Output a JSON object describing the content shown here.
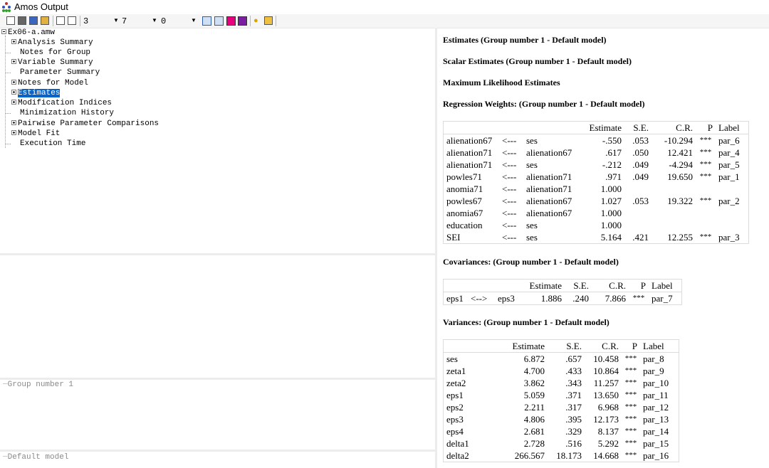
{
  "window": {
    "title": "Amos Output"
  },
  "toolbar": {
    "decimals": "3",
    "column_spacing": "7",
    "table_rows": "0"
  },
  "tree": {
    "root": "Ex06-a.amw",
    "items": [
      {
        "label": "Analysis Summary",
        "expandable": true
      },
      {
        "label": "Notes for Group",
        "expandable": false
      },
      {
        "label": "Variable Summary",
        "expandable": true
      },
      {
        "label": "Parameter Summary",
        "expandable": false
      },
      {
        "label": "Notes for Model",
        "expandable": true
      },
      {
        "label": "Estimates",
        "expandable": true,
        "selected": true
      },
      {
        "label": "Modification Indices",
        "expandable": true
      },
      {
        "label": "Minimization History",
        "expandable": false
      },
      {
        "label": "Pairwise Parameter Comparisons",
        "expandable": true
      },
      {
        "label": "Model Fit",
        "expandable": true
      },
      {
        "label": "Execution Time",
        "expandable": false
      }
    ]
  },
  "groups_pane": {
    "label": "Group number 1"
  },
  "models_pane": {
    "label": "Default model"
  },
  "output": {
    "h_estimates": "Estimates (Group number 1 - Default model)",
    "h_scalar": "Scalar Estimates (Group number 1 - Default model)",
    "h_ml": "Maximum Likelihood Estimates",
    "h_regression": "Regression Weights: (Group number 1 - Default model)",
    "h_covariances": "Covariances: (Group number 1 - Default model)",
    "h_variances": "Variances: (Group number 1 - Default model)",
    "columns": [
      "Estimate",
      "S.E.",
      "C.R.",
      "P",
      "Label"
    ],
    "regression": [
      [
        "alienation67",
        "<---",
        "ses",
        "-.550",
        ".053",
        "-10.294",
        "***",
        "par_6"
      ],
      [
        "alienation71",
        "<---",
        "alienation67",
        ".617",
        ".050",
        "12.421",
        "***",
        "par_4"
      ],
      [
        "alienation71",
        "<---",
        "ses",
        "-.212",
        ".049",
        "-4.294",
        "***",
        "par_5"
      ],
      [
        "powles71",
        "<---",
        "alienation71",
        ".971",
        ".049",
        "19.650",
        "***",
        "par_1"
      ],
      [
        "anomia71",
        "<---",
        "alienation71",
        "1.000",
        "",
        "",
        "",
        ""
      ],
      [
        "powles67",
        "<---",
        "alienation67",
        "1.027",
        ".053",
        "19.322",
        "***",
        "par_2"
      ],
      [
        "anomia67",
        "<---",
        "alienation67",
        "1.000",
        "",
        "",
        "",
        ""
      ],
      [
        "education",
        "<---",
        "ses",
        "1.000",
        "",
        "",
        "",
        ""
      ],
      [
        "SEI",
        "<---",
        "ses",
        "5.164",
        ".421",
        "12.255",
        "***",
        "par_3"
      ]
    ],
    "covariances": [
      [
        "eps1",
        "<-->",
        "eps3",
        "1.886",
        ".240",
        "7.866",
        "***",
        "par_7"
      ]
    ],
    "variances": [
      [
        "ses",
        "6.872",
        ".657",
        "10.458",
        "***",
        "par_8"
      ],
      [
        "zeta1",
        "4.700",
        ".433",
        "10.864",
        "***",
        "par_9"
      ],
      [
        "zeta2",
        "3.862",
        ".343",
        "11.257",
        "***",
        "par_10"
      ],
      [
        "eps1",
        "5.059",
        ".371",
        "13.650",
        "***",
        "par_11"
      ],
      [
        "eps2",
        "2.211",
        ".317",
        "6.968",
        "***",
        "par_12"
      ],
      [
        "eps3",
        "4.806",
        ".395",
        "12.173",
        "***",
        "par_13"
      ],
      [
        "eps4",
        "2.681",
        ".329",
        "8.137",
        "***",
        "par_14"
      ],
      [
        "delta1",
        "2.728",
        ".516",
        "5.292",
        "***",
        "par_15"
      ],
      [
        "delta2",
        "266.567",
        "18.173",
        "14.668",
        "***",
        "par_16"
      ]
    ]
  }
}
